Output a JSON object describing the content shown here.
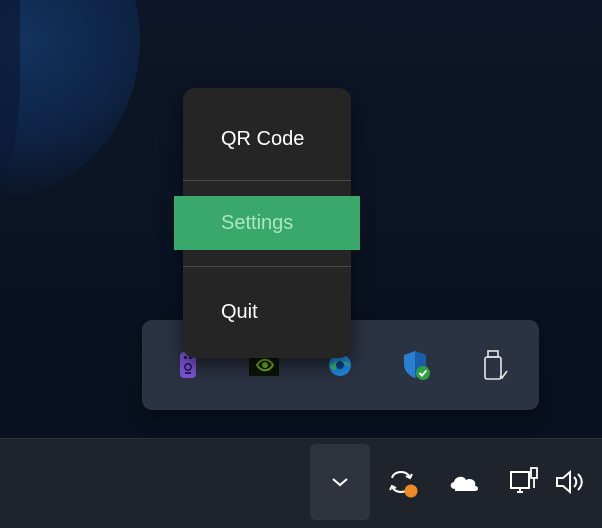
{
  "context_menu": {
    "items": [
      {
        "label": "QR Code"
      },
      {
        "label": "Settings",
        "highlighted": true
      },
      {
        "label": "Quit"
      }
    ]
  },
  "tray_flyout": {
    "icons": [
      {
        "name": "remote-control-icon",
        "color": "#7b55d6"
      },
      {
        "name": "nvidia-icon",
        "color": "#76b900"
      },
      {
        "name": "edge-update-icon",
        "color": "#1f8ae0"
      },
      {
        "name": "windows-security-icon",
        "color": "#2a7fd0"
      },
      {
        "name": "usb-device-icon",
        "color": "#e6e6e6"
      }
    ]
  },
  "taskbar": {
    "chevron_icon": "chevron-up-icon",
    "icons": [
      {
        "name": "sync-icon",
        "badge_color": "#f08a24"
      },
      {
        "name": "onedrive-icon"
      },
      {
        "name": "network-icon"
      },
      {
        "name": "volume-icon"
      }
    ]
  },
  "colors": {
    "menu_bg": "#252525",
    "highlight": "#3aa86a",
    "highlight_text": "#a9e6c2",
    "flyout_bg": "#2b3242",
    "taskbar_bg": "#1f232b"
  }
}
